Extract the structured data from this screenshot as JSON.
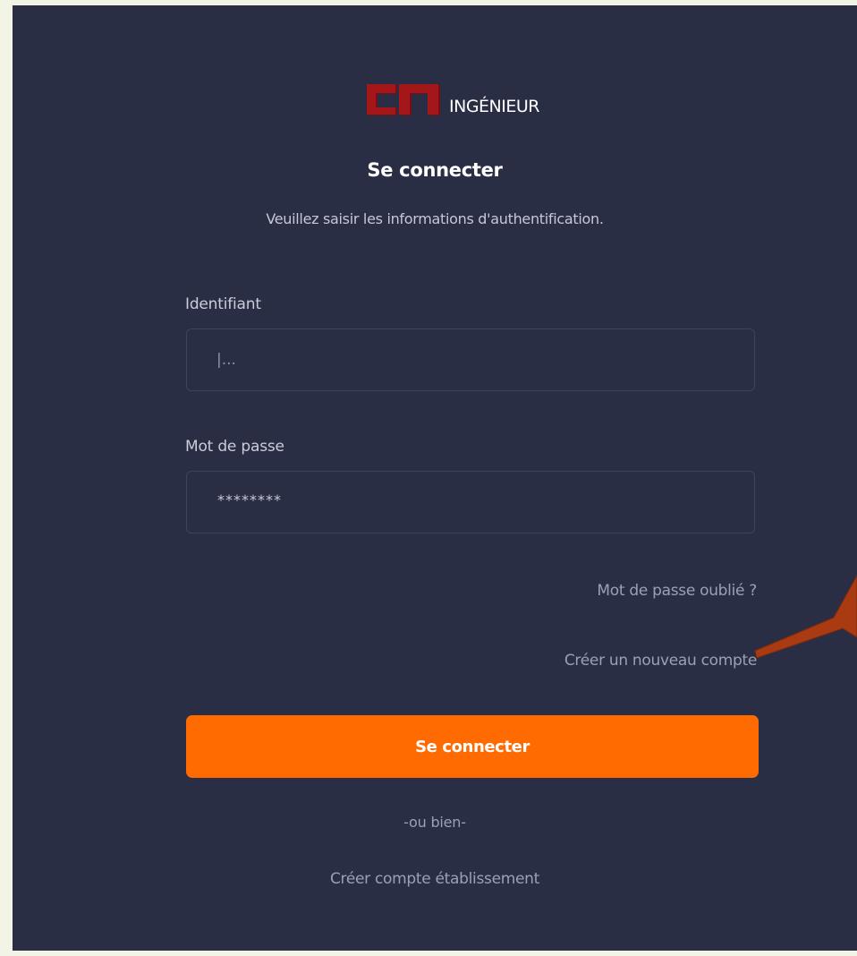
{
  "brand": {
    "logo_name": "INGÉNIEUR",
    "logo_colors": {
      "mark": "#a3161a",
      "mark_shadow": "#7a0e12"
    }
  },
  "header": {
    "title": "Se connecter",
    "subtitle": "Veuillez saisir les informations d'authentification."
  },
  "form": {
    "username": {
      "label": "Identifiant",
      "placeholder": "|..."
    },
    "password": {
      "label": "Mot de passe",
      "value": "********"
    },
    "forgot_password": "Mot de passe oublié ?",
    "create_account": "Créer un nouveau compte",
    "submit_label": "Se connecter",
    "divider": "-ou bien-",
    "create_establishment": "Créer compte établissement"
  },
  "colors": {
    "background": "#2a2e45",
    "page_background": "#f2f4e6",
    "accent": "#ff6b00",
    "annotation_arrow": "#a93a12"
  }
}
